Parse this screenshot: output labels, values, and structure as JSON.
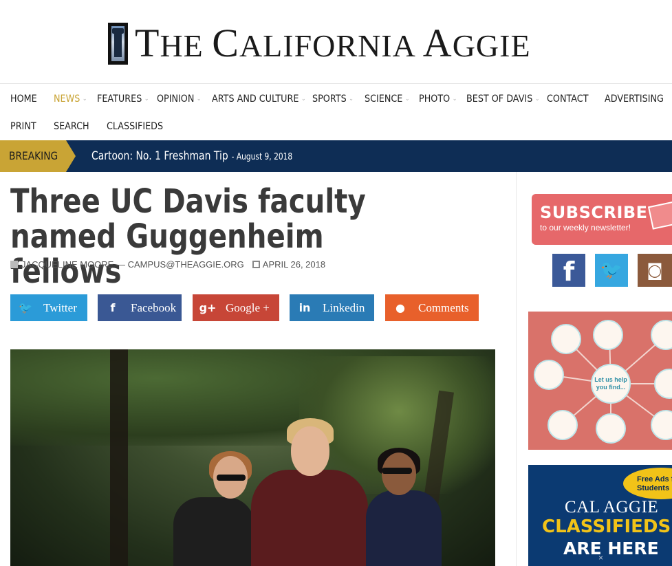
{
  "masthead": {
    "title_first": "T",
    "title_rest_1": "HE ",
    "title_c": "C",
    "title_rest_2": "ALIFORNIA ",
    "title_a": "A",
    "title_rest_3": "GGIE"
  },
  "nav": {
    "items": [
      {
        "label": "Home",
        "has_caret": false
      },
      {
        "label": "News",
        "has_caret": true,
        "active": true
      },
      {
        "label": "Features",
        "has_caret": true
      },
      {
        "label": "Opinion",
        "has_caret": true
      },
      {
        "label": "Arts and Culture",
        "has_caret": true
      },
      {
        "label": "Sports",
        "has_caret": true
      },
      {
        "label": "Science",
        "has_caret": true
      },
      {
        "label": "Photo",
        "has_caret": true
      },
      {
        "label": "Best of Davis",
        "has_caret": true
      },
      {
        "label": "Contact",
        "has_caret": false
      },
      {
        "label": "Advertising",
        "has_caret": false
      },
      {
        "label": "Print",
        "has_caret": false
      },
      {
        "label": "Search",
        "has_caret": false
      },
      {
        "label": "Classifieds",
        "has_caret": false
      }
    ],
    "active_color": "#c9a435"
  },
  "breaking": {
    "label": "BREAKING",
    "headline": "Cartoon: No. 1 Freshman Tip",
    "date": "- August 9, 2018",
    "bar_color": "#0e2d55",
    "label_color": "#c9a435"
  },
  "article": {
    "title": "Three UC Davis faculty named Guggenheim fellows",
    "author": "JACQUELINE MOORE — CAMPUS@THEAGGIE.ORG",
    "date": "APRIL 26, 2018"
  },
  "share": {
    "twitter": {
      "icon": "twitter-icon",
      "label": "Twitter",
      "color": "#2b9bd8"
    },
    "facebook": {
      "icon": "facebook-icon",
      "label": "Facebook",
      "color": "#3a5894"
    },
    "google": {
      "icon": "google-plus-icon",
      "label": "Google +",
      "color": "#c74637"
    },
    "linkedin": {
      "icon": "linkedin-icon",
      "label": "Linkedin",
      "color": "#2a7bb5"
    },
    "comments": {
      "icon": "comment-icon",
      "label": "Comments",
      "color": "#e8602b"
    }
  },
  "sidebar": {
    "subscribe": {
      "title": "SUBSCRIBE",
      "subtitle": "to our weekly newsletter!"
    },
    "social": [
      {
        "icon": "facebook-icon",
        "glyph": "f"
      },
      {
        "icon": "twitter-icon",
        "glyph": "t"
      },
      {
        "icon": "instagram-icon",
        "glyph": "◙"
      }
    ],
    "library_ad": {
      "hub_text": "Let us help you find..."
    },
    "classifieds_ad": {
      "badge": "Free Ads for Students",
      "line1": "CAL AGGIE",
      "line2": "CLASSIFIEDS",
      "line3": "ARE HERE",
      "close_glyph": "×"
    }
  }
}
